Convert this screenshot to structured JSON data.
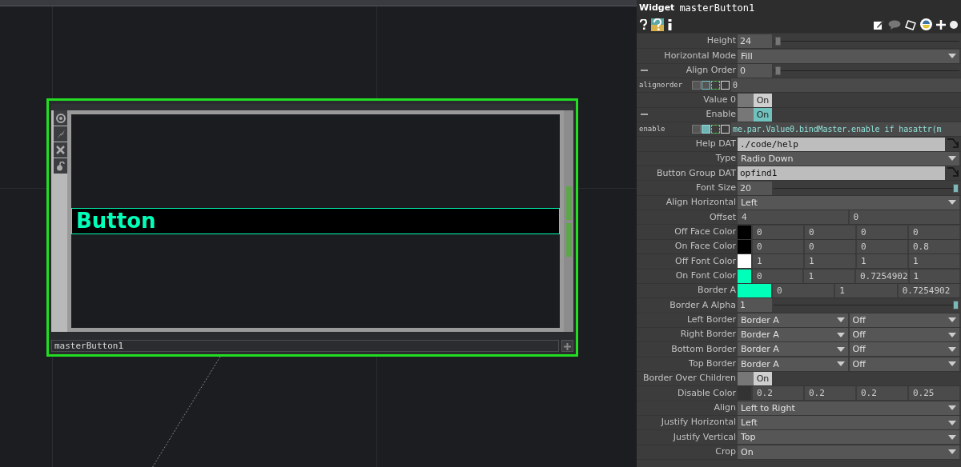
{
  "node": {
    "name": "masterButton1",
    "button_label": "Button"
  },
  "panel": {
    "type": "Widget",
    "name": "masterButton1"
  },
  "params": [
    {
      "kind": "slider",
      "label": "Height",
      "value": "24",
      "level": 0.01
    },
    {
      "kind": "menu",
      "label": "Horizontal Mode",
      "value": "Fill"
    },
    {
      "kind": "slider",
      "label": "Align Order",
      "value": "0",
      "level": 0.01,
      "dash": true
    },
    {
      "kind": "expr",
      "label": "alignorder",
      "value": "0",
      "expression": false
    },
    {
      "kind": "toggle",
      "label": "Value 0",
      "value": "On",
      "highlighted": false
    },
    {
      "kind": "toggle",
      "label": "Enable",
      "value": "On",
      "highlighted": true,
      "dash": true
    },
    {
      "kind": "expr",
      "label": "enable",
      "value": "me.par.Value0.bindMaster.enable if hasattr(m",
      "expression": true
    },
    {
      "kind": "field",
      "label": "Help DAT",
      "value": "./code/help"
    },
    {
      "kind": "menu",
      "label": "Type",
      "value": "Radio Down"
    },
    {
      "kind": "field",
      "label": "Button Group DAT",
      "value": "opfind1"
    },
    {
      "kind": "slider",
      "label": "Font Size",
      "value": "20",
      "level": 1
    },
    {
      "kind": "menu",
      "label": "Align Horizontal",
      "value": "Left"
    },
    {
      "kind": "numbers",
      "label": "Offset",
      "values": [
        "4",
        "0"
      ]
    },
    {
      "kind": "numbers",
      "label": "Off Face Color",
      "color": "#000000",
      "values": [
        "0",
        "0",
        "0",
        "0"
      ]
    },
    {
      "kind": "numbers",
      "label": "On Face Color",
      "color": "#000000",
      "values": [
        "0",
        "0",
        "0",
        "0.8"
      ]
    },
    {
      "kind": "numbers",
      "label": "Off Font Color",
      "color": "#ffffff",
      "values": [
        "1",
        "1",
        "1",
        "1"
      ]
    },
    {
      "kind": "numbers",
      "label": "On Font Color",
      "color": "#00ffb9",
      "values": [
        "0",
        "1",
        "0.7254902",
        "1"
      ]
    },
    {
      "kind": "numbers",
      "label": "Border A",
      "color": "#00ffb9",
      "wide": true,
      "values": [
        "0",
        "1",
        "0.7254902"
      ]
    },
    {
      "kind": "slider",
      "label": "Border A Alpha",
      "value": "1",
      "level": 1
    },
    {
      "kind": "menu2",
      "label": "Left Border",
      "values": [
        "Border A",
        "Off"
      ]
    },
    {
      "kind": "menu2",
      "label": "Right Border",
      "values": [
        "Border A",
        "Off"
      ]
    },
    {
      "kind": "menu2",
      "label": "Bottom Border",
      "values": [
        "Border A",
        "Off"
      ]
    },
    {
      "kind": "menu2",
      "label": "Top Border",
      "values": [
        "Border A",
        "Off"
      ]
    },
    {
      "kind": "toggle",
      "label": "Border Over Children",
      "value": "On",
      "highlighted": false
    },
    {
      "kind": "numbers",
      "label": "Disable Color",
      "color": "#333333",
      "values": [
        "0.2",
        "0.2",
        "0.2",
        "0.25"
      ]
    },
    {
      "kind": "menu",
      "label": "Align",
      "value": "Left to Right"
    },
    {
      "kind": "menu",
      "label": "Justify Horizontal",
      "value": "Left"
    },
    {
      "kind": "menu",
      "label": "Justify Vertical",
      "value": "Top"
    },
    {
      "kind": "menu",
      "label": "Crop",
      "value": "On"
    }
  ]
}
